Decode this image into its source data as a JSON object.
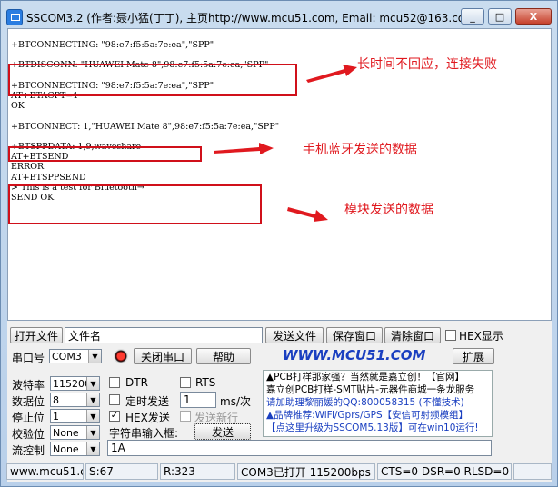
{
  "window": {
    "title": "SSCOM3.2 (作者:聂小猛(丁丁), 主页http://www.mcu51.com,  Email: mcu52@163.co...",
    "minimize_label": "_",
    "maximize_label": "□",
    "close_label": "X"
  },
  "terminal": {
    "lines": [
      "+BTCONNECTING: \"98:e7:f5:5a:7e:ea\",\"SPP\"",
      "",
      "+BTDISCONN: \"HUAWEI Mate 8\",98:e7:f5:5a:7e:ea,\"SPP\"",
      "",
      "+BTCONNECTING: \"98:e7:f5:5a:7e:ea\",\"SPP\"",
      "AT+BTACPT=1",
      "OK",
      "",
      "+BTCONNECT: 1,\"HUAWEI Mate 8\",98:e7:f5:5a:7e:ea,\"SPP\"",
      "",
      "+BTSPPDATA: 1,9,waveshare",
      "AT+BTSEND",
      "ERROR",
      "AT+BTSPPSEND",
      "> This is a test for Bluetooth→",
      "SEND OK"
    ]
  },
  "annotations": {
    "note1": "长时间不回应，连接失败",
    "note2": "手机蓝牙发送的数据",
    "note3": "模块发送的数据"
  },
  "toolbar": {
    "open_file": "打开文件",
    "file_name": "文件名",
    "send_file": "发送文件",
    "save_window": "保存窗口",
    "clear_window": "清除窗口",
    "hex_display": "HEX显示"
  },
  "port_row": {
    "port_label": "串口号",
    "port_value": "COM3",
    "close_port": "关闭串口",
    "help": "帮助",
    "brand": "WWW.MCU51.COM",
    "expand": "扩展"
  },
  "settings": {
    "baud_label": "波特率",
    "baud_value": "115200",
    "databits_label": "数据位",
    "databits_value": "8",
    "stopbits_label": "停止位",
    "stopbits_value": "1",
    "parity_label": "校验位",
    "parity_value": "None",
    "flow_label": "流控制",
    "flow_value": "None"
  },
  "options": {
    "dtr": "DTR",
    "rts": "RTS",
    "timed_send": "定时发送",
    "interval_value": "1",
    "interval_unit": "ms/次",
    "hex_send": "HEX发送",
    "send_newline": "发送新行",
    "input_label": "字符串输入框:",
    "send_button": "发送",
    "input_value": "1A"
  },
  "promo": {
    "line1": "▲PCB打样那家强？当然就是嘉立创！【官网】",
    "line2": "嘉立创PCB打样-SMT贴片-元器件商城一条龙服务",
    "line3": "请加助理黎丽媛的QQ:800058315 (不懂技术)",
    "line4": "▲品牌推荐:WiFi/Gprs/GPS【安信可射频模组】",
    "line5": "【点这里升级为SSCOM5.13版】可在win10运行!"
  },
  "status_bar": {
    "site": "www.mcu51.cor",
    "sent": "S:67",
    "received": "R:323",
    "port_state": "COM3已打开  115200bps",
    "signals": "CTS=0 DSR=0 RLSD=0"
  },
  "colors": {
    "annotation_red": "#e0191f",
    "brand_blue": "#1a3fc0",
    "promo_blue": "#1a3fc0"
  }
}
